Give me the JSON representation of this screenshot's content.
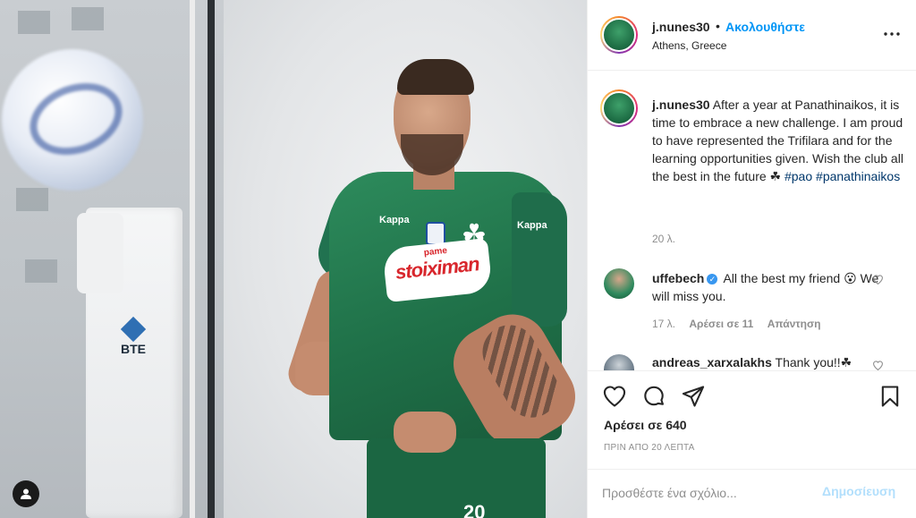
{
  "post": {
    "username": "j.nunes30",
    "separator": "•",
    "follow_label": "Ακολουθήστε",
    "location": "Athens, Greece",
    "more_icon": "more-horizontal-icon",
    "more_glyph": "•••"
  },
  "photo": {
    "sponsor_small": "pame",
    "sponsor_main": "stoiximan",
    "brand_left": "Kappa",
    "brand_right": "Kappa",
    "clover_glyph": "☘",
    "machine_brand": "BTE",
    "shorts_number": "20",
    "tag_icon": "user-tag-icon"
  },
  "caption": {
    "username": "j.nunes30",
    "text": "After a year at Panathinaikos, it is time to embrace a new challenge. I am proud to have represented the Trifilara and for the learning opportunities given. Wish the club all the best in the future ☘ ",
    "hashtag1": "#pao",
    "hashtag2": "#panathinaikos",
    "time": "20 λ."
  },
  "comments": [
    {
      "username": "uffebech",
      "verified_glyph": "✓",
      "text": "All the best my friend 😮 We will miss you.",
      "time": "17 λ.",
      "likes": "Αρέσει σε 11",
      "reply": "Απάντηση"
    },
    {
      "username": "andreas_xarxalakhs",
      "text": "Thank you!!☘"
    }
  ],
  "actions": {
    "like_icon": "heart-icon",
    "comment_icon": "comment-icon",
    "share_icon": "share-icon",
    "save_icon": "bookmark-icon",
    "likes_text": "Αρέσει σε 640",
    "time_ago": "ΠΡΙΝ ΑΠΟ 20 ΛΕΠΤΑ"
  },
  "add_comment": {
    "placeholder": "Προσθέστε ένα σχόλιο...",
    "post_label": "Δημοσίευση"
  },
  "colors": {
    "link_blue": "#0095f6",
    "post_disabled": "#b2dffc",
    "jersey_green": "#1f7048"
  }
}
